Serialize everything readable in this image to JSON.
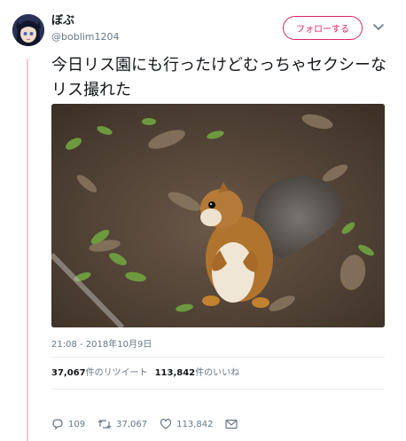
{
  "user": {
    "display_name": "ぼぶ",
    "handle": "@boblim1204"
  },
  "follow_button": {
    "label": "フォローする"
  },
  "tweet": {
    "text": "今日リス園にも行ったけどむっちゃセクシーなリス撮れた",
    "timestamp": "21:08 - 2018年10月9日"
  },
  "stats": {
    "retweets_count": "37,067",
    "retweets_label": "件のリツイート",
    "likes_count": "113,842",
    "likes_label": "件のいいね"
  },
  "actions": {
    "replies": "109",
    "retweets": "37,067",
    "likes": "113,842"
  },
  "colors": {
    "accent": "#e0245e",
    "muted": "#657786",
    "thread_line": "#f7c7d3"
  }
}
